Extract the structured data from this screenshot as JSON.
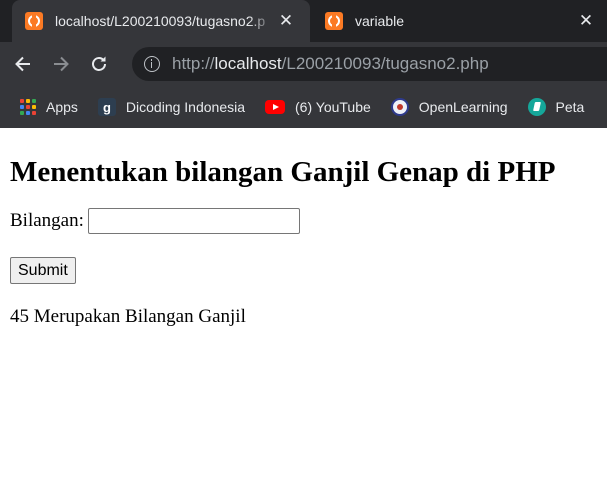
{
  "browser": {
    "tabs": [
      {
        "title": "localhost/L200210093/tugasno2.p",
        "icon": "xampp-icon",
        "active": true,
        "close": "✕"
      },
      {
        "title": "variable",
        "icon": "xampp-icon",
        "active": false,
        "close": "✕"
      }
    ],
    "url": {
      "scheme": "http://",
      "host": "localhost",
      "path": "/L200210093/tugasno2.php"
    },
    "bookmarks": [
      {
        "label": "Apps",
        "icon": "apps-grid-icon"
      },
      {
        "label": "Dicoding Indonesia",
        "icon": "dicoding-icon",
        "glyph": "g"
      },
      {
        "label": "(6) YouTube",
        "icon": "youtube-icon"
      },
      {
        "label": "OpenLearning",
        "icon": "openlearning-icon"
      },
      {
        "label": "Peta",
        "icon": "peta-icon"
      }
    ],
    "colors": {
      "tabstrip": "#202124",
      "toolbar": "#35363a",
      "xampp": "#fb7a24"
    }
  },
  "page": {
    "heading": "Menentukan bilangan Ganjil Genap di PHP",
    "form": {
      "label": "Bilangan:",
      "input_value": "",
      "submit_label": "Submit"
    },
    "result": "45 Merupakan Bilangan Ganjil"
  }
}
